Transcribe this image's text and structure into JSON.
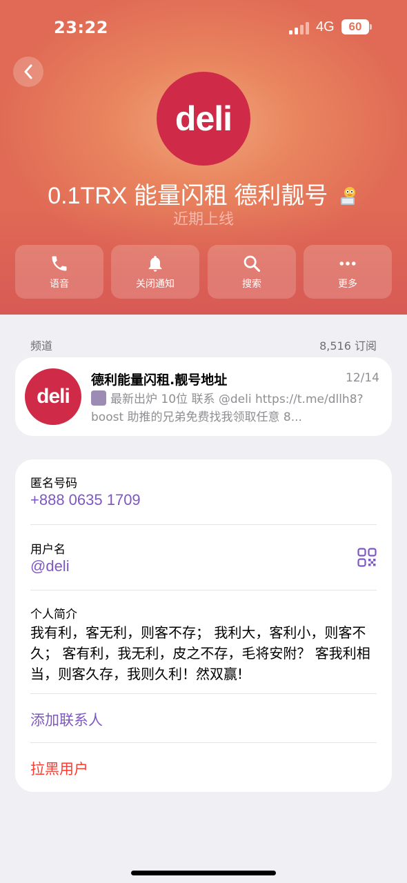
{
  "status_bar": {
    "time": "23:22",
    "network": "4G",
    "battery": "60"
  },
  "header": {
    "avatar_text": "deli",
    "title": "0.1TRX 能量闪租 德利靓号",
    "title_emoji": "duck-laptop-emoji",
    "subtitle": "近期上线",
    "accent_color": "#e07558"
  },
  "actions": [
    {
      "icon": "phone-icon",
      "label": "语音"
    },
    {
      "icon": "bell-icon",
      "label": "关闭通知"
    },
    {
      "icon": "search-icon",
      "label": "搜索"
    },
    {
      "icon": "more-icon",
      "label": "更多"
    }
  ],
  "channel_section": {
    "label": "频道",
    "subscribers": "8,516 订阅",
    "card": {
      "avatar_text": "deli",
      "title": "德利能量闪租.靓号地址",
      "date": "12/14",
      "preview": "最新出炉 10位 联系 @deli https://t.me/dllh8?boost 助推的兄弟免费找我领取任意 8..."
    }
  },
  "info": {
    "phone_label": "匿名号码",
    "phone_value": "+888 0635 1709",
    "username_label": "用户名",
    "username_value": "@deli",
    "bio_label": "个人简介",
    "bio_text": "我有利，客无利，则客不存； 我利大，客利小，则客不久； 客有利，我无利，皮之不存，毛将安附？ 客我利相当，则客久存，我则久利！然双赢!",
    "add_contact": "添加联系人",
    "block_user": "拉黑用户"
  }
}
